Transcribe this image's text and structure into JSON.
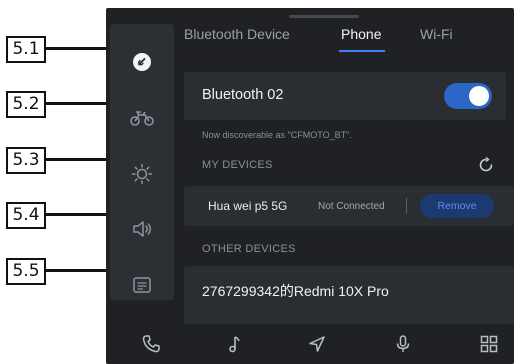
{
  "callouts": [
    "5.1",
    "5.2",
    "5.3",
    "5.4",
    "5.5"
  ],
  "sidebar": {
    "items": [
      {
        "icon": "link-icon",
        "active": true
      },
      {
        "icon": "motorcycle-icon",
        "active": false
      },
      {
        "icon": "brightness-icon",
        "active": false
      },
      {
        "icon": "volume-icon",
        "active": false
      },
      {
        "icon": "display-icon",
        "active": false
      }
    ]
  },
  "tabs": [
    {
      "label": "Bluetooth Device",
      "active": false
    },
    {
      "label": "Phone",
      "active": true
    },
    {
      "label": "Wi-Fi",
      "active": false
    }
  ],
  "bluetooth": {
    "name": "Bluetooth 02",
    "enabled": true,
    "discoverable_text": "Now discoverable as \"CFMOTO_BT\"."
  },
  "my_devices": {
    "title": "MY DEVICES",
    "refresh_icon": "refresh-icon",
    "items": [
      {
        "name": "Hua wei p5 5G",
        "status": "Not Connected",
        "action": "Remove"
      }
    ]
  },
  "other_devices": {
    "title": "OTHER DEVICES",
    "items": [
      {
        "name": "2767299342的Redmi 10X Pro"
      }
    ]
  },
  "bottom_bar": [
    "phone-icon",
    "music-icon",
    "navigation-icon",
    "microphone-icon",
    "apps-grid-icon"
  ],
  "colors": {
    "background": "#1f2125",
    "panel": "#2a2d32",
    "accent": "#3f7df0",
    "toggle_on": "#2e66c7"
  }
}
